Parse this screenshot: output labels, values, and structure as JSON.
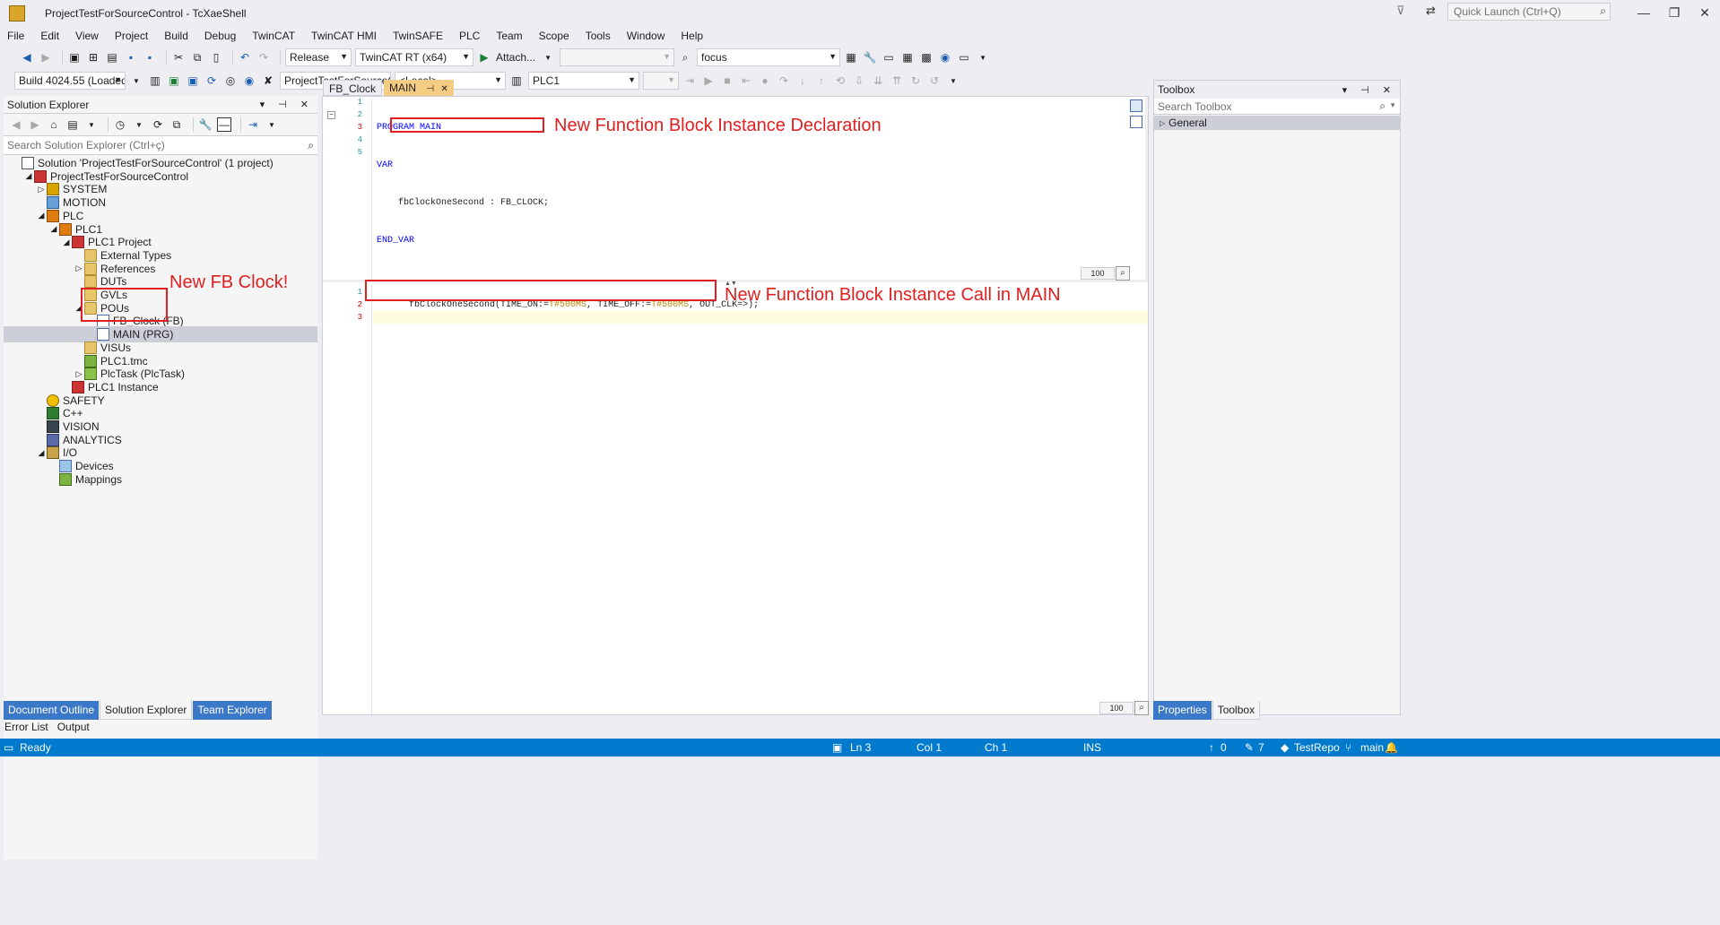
{
  "window": {
    "title": "ProjectTestForSourceControl - TcXaeShell",
    "quick_launch_placeholder": "Quick Launch (Ctrl+Q)",
    "minimize": "—",
    "restore": "❐",
    "close": "✕"
  },
  "menu": [
    "File",
    "Edit",
    "View",
    "Project",
    "Build",
    "Debug",
    "TwinCAT",
    "TwinCAT HMI",
    "TwinSAFE",
    "PLC",
    "Team",
    "Scope",
    "Tools",
    "Window",
    "Help"
  ],
  "toolbar1": {
    "config": "Release",
    "platform": "TwinCAT RT (x64)",
    "attach": "Attach...",
    "find": "focus"
  },
  "toolbar2": {
    "build": "Build 4024.55 (Loaded)",
    "project": "ProjectTestForSourceCor",
    "target": "<Local>",
    "plc": "PLC1"
  },
  "solution_explorer": {
    "title": "Solution Explorer",
    "search_placeholder": "Search Solution Explorer (Ctrl+ç)",
    "tree": [
      {
        "label": "Solution 'ProjectTestForSourceControl' (1 project)",
        "icon": "solution-icon",
        "depth": 0,
        "twisty": ""
      },
      {
        "label": "ProjectTestForSourceControl",
        "icon": "project-icon",
        "depth": 1,
        "twisty": "expanded"
      },
      {
        "label": "SYSTEM",
        "icon": "system-icon",
        "depth": 2,
        "twisty": "collapsed"
      },
      {
        "label": "MOTION",
        "icon": "motion-icon",
        "depth": 2,
        "twisty": ""
      },
      {
        "label": "PLC",
        "icon": "plc-icon",
        "depth": 2,
        "twisty": "expanded"
      },
      {
        "label": "PLC1",
        "icon": "plc-icon",
        "depth": 3,
        "twisty": "expanded"
      },
      {
        "label": "PLC1 Project",
        "icon": "project-icon",
        "depth": 4,
        "twisty": "expanded"
      },
      {
        "label": "External Types",
        "icon": "folder-icon",
        "depth": 5,
        "twisty": ""
      },
      {
        "label": "References",
        "icon": "folder-icon",
        "depth": 5,
        "twisty": "collapsed"
      },
      {
        "label": "DUTs",
        "icon": "folder-icon",
        "depth": 5,
        "twisty": ""
      },
      {
        "label": "GVLs",
        "icon": "folder-icon",
        "depth": 5,
        "twisty": ""
      },
      {
        "label": "POUs",
        "icon": "folder-icon",
        "depth": 5,
        "twisty": "expanded"
      },
      {
        "label": "FB_Clock (FB)",
        "icon": "file-icon",
        "depth": 6,
        "twisty": ""
      },
      {
        "label": "MAIN (PRG)",
        "icon": "file-icon",
        "depth": 6,
        "twisty": "",
        "selected": true
      },
      {
        "label": "VISUs",
        "icon": "folder-icon",
        "depth": 5,
        "twisty": ""
      },
      {
        "label": "PLC1.tmc",
        "icon": "tmc-icon",
        "depth": 5,
        "twisty": ""
      },
      {
        "label": "PlcTask (PlcTask)",
        "icon": "task-icon",
        "depth": 5,
        "twisty": "collapsed"
      },
      {
        "label": "PLC1 Instance",
        "icon": "instance-icon",
        "depth": 4,
        "twisty": ""
      },
      {
        "label": "SAFETY",
        "icon": "safety-icon",
        "depth": 2,
        "twisty": ""
      },
      {
        "label": "C++",
        "icon": "cpp-icon",
        "depth": 2,
        "twisty": ""
      },
      {
        "label": "VISION",
        "icon": "vision-icon",
        "depth": 2,
        "twisty": ""
      },
      {
        "label": "ANALYTICS",
        "icon": "analytics-icon",
        "depth": 2,
        "twisty": ""
      },
      {
        "label": "I/O",
        "icon": "io-icon",
        "depth": 2,
        "twisty": "expanded"
      },
      {
        "label": "Devices",
        "icon": "devices-icon",
        "depth": 3,
        "twisty": ""
      },
      {
        "label": "Mappings",
        "icon": "mappings-icon",
        "depth": 3,
        "twisty": ""
      }
    ],
    "bottom_tabs": [
      "Document Outline",
      "Solution Explorer",
      "Team Explorer"
    ]
  },
  "editor": {
    "tabs": [
      {
        "label": "FB_Clock",
        "active": false
      },
      {
        "label": "MAIN",
        "active": true,
        "pin": "⊣"
      }
    ],
    "decl_lines": [
      "1",
      "2",
      "3",
      "4",
      "5"
    ],
    "decl_code": [
      {
        "kw": "PROGRAM MAIN",
        "rest": ""
      },
      {
        "kw": "VAR",
        "rest": ""
      },
      {
        "kw": "",
        "rest": "    fbClockOneSecond : FB_CLOCK;"
      },
      {
        "kw": "END_VAR",
        "rest": ""
      },
      {
        "kw": "",
        "rest": ""
      }
    ],
    "impl_lines": [
      "1",
      "2",
      "3"
    ],
    "impl_code": {
      "fn": "fbClockOneSecond(TIME_ON:=",
      "lit1": "T#500MS",
      "mid": ", TIME_OFF:=",
      "lit2": "T#500MS",
      "end": ", OUT_CLK=>);"
    },
    "zoom": "100"
  },
  "annotations": {
    "decl": "New Function Block Instance Declaration",
    "call": "New Function Block Instance Call in MAIN",
    "fb": "New FB Clock!"
  },
  "toolbox": {
    "title": "Toolbox",
    "search_placeholder": "Search Toolbox",
    "group": "General",
    "bottom_tabs": [
      "Properties",
      "Toolbox"
    ]
  },
  "output_tabs": [
    "Error List",
    "Output"
  ],
  "status": {
    "ready": "Ready",
    "ln": "Ln 3",
    "col": "Col 1",
    "ch": "Ch 1",
    "ins": "INS",
    "up": "0",
    "pending": "7",
    "repo": "TestRepo",
    "branch": "main"
  },
  "colors": {
    "accent": "#007acc",
    "annotation": "#e02020",
    "active_tab": "#f5cc84"
  }
}
